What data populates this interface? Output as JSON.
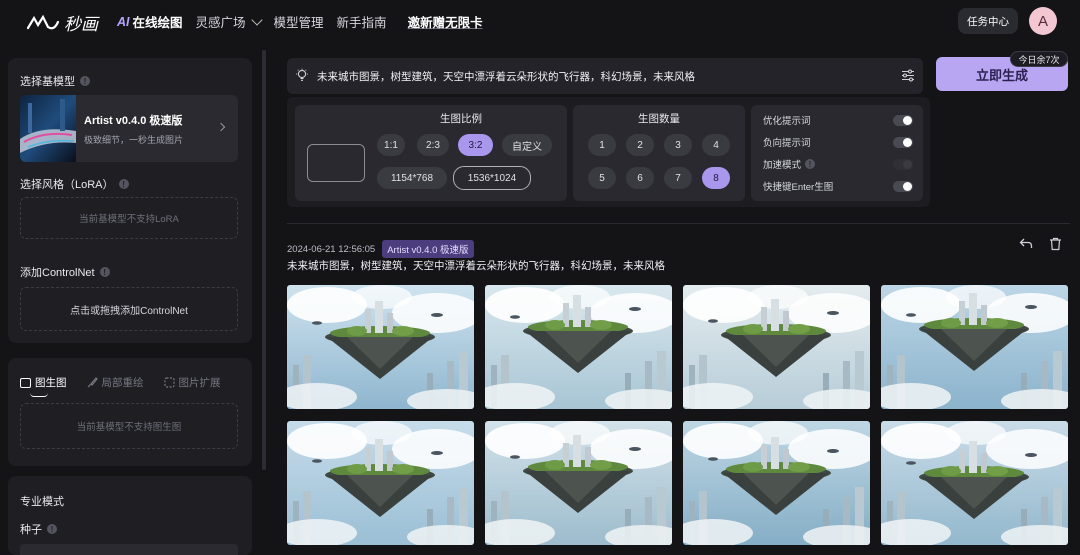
{
  "app": {
    "logo_text": "秒画"
  },
  "nav": {
    "ai_prefix": "AI",
    "items": [
      "在线绘图",
      "灵感广场",
      "模型管理",
      "新手指南",
      "邀新赠无限卡"
    ]
  },
  "header": {
    "task_center": "任务中心",
    "avatar_letter": "A"
  },
  "sidebar": {
    "base_model_title": "选择基模型",
    "model_name": "Artist v0.4.0 极速版",
    "model_desc": "极致细节，一秒生成图片",
    "lora_title": "选择风格（LoRA）",
    "lora_empty": "当前基模型不支持LoRA",
    "controlnet_title": "添加ControlNet",
    "controlnet_hint": "点击或拖拽添加ControlNet",
    "tabs": [
      "图生图",
      "局部重绘",
      "图片扩展"
    ],
    "img2img_empty": "当前基模型不支持图生图",
    "pro_title": "专业模式",
    "seed_label": "种子"
  },
  "prompt": {
    "text": "未来城市图景，树型建筑，天空中漂浮着云朵形状的飞行器，科幻场景，未来风格",
    "generate_label": "立即生成",
    "today_remaining": "今日余7次"
  },
  "settings": {
    "ratio_title": "生图比例",
    "ratios": [
      "1:1",
      "2:3",
      "3:2",
      "自定义"
    ],
    "selected_ratio": "3:2",
    "sizes": [
      "1154*768",
      "1536*1024"
    ],
    "selected_size": "1536*1024",
    "count_title": "生图数量",
    "counts": [
      "1",
      "2",
      "3",
      "4",
      "5",
      "6",
      "7",
      "8"
    ],
    "selected_count": "8",
    "toggles": [
      {
        "label": "优化提示词",
        "on": false,
        "info": false,
        "disabled": false
      },
      {
        "label": "负向提示词",
        "on": false,
        "info": false,
        "disabled": false
      },
      {
        "label": "加速模式",
        "on": false,
        "info": true,
        "disabled": true
      },
      {
        "label": "快捷键Enter生图",
        "on": false,
        "info": false,
        "disabled": false
      }
    ]
  },
  "result": {
    "timestamp": "2024-06-21 12:56:05",
    "model_badge": "Artist v0.4.0 极速版",
    "prompt": "未来城市图景，树型建筑，天空中漂浮着云朵形状的飞行器，科幻场景，未来风格",
    "image_count": 8
  },
  "colors": {
    "accent": "#b8a6f2",
    "accent_selected": "#a997ee",
    "bg": "#141417",
    "panel": "#1e1e23"
  },
  "icons": [
    "bulb-icon",
    "sliders-icon",
    "undo-icon",
    "trash-icon",
    "info-icon",
    "chevron-right-icon",
    "chevron-down-icon"
  ]
}
